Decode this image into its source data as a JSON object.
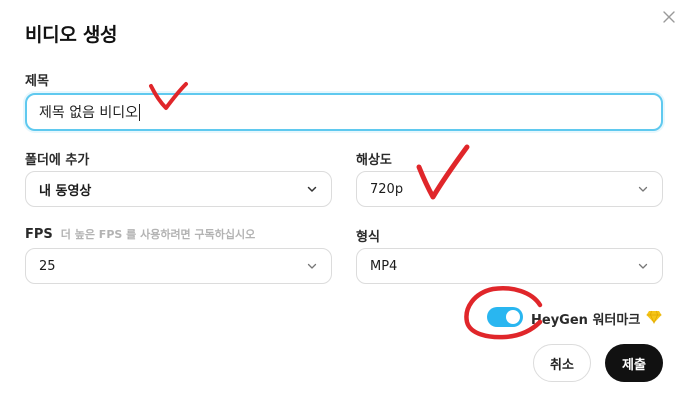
{
  "dialog": {
    "title": "비디오 생성"
  },
  "form": {
    "title_label": "제목",
    "title_value": "제목 없음 비디오",
    "folder_label": "폴더에 추가",
    "folder_value": "내 동영상",
    "resolution_label": "해상도",
    "resolution_value": "720p",
    "fps_label": "FPS",
    "fps_hint": "더 높은 FPS 를 사용하려면 구독하십시오",
    "fps_value": "25",
    "format_label": "형식",
    "format_value": "MP4",
    "watermark_label": "HeyGen 워터마크",
    "watermark_enabled": true
  },
  "buttons": {
    "cancel": "취소",
    "submit": "제출"
  },
  "icons": {
    "close": "close-icon",
    "chevron": "chevron-down-icon",
    "premium": "diamond-icon"
  },
  "colors": {
    "accent": "#29b6f0",
    "focus_border": "#5fc9ef",
    "annotation": "#e0262a",
    "premium": "#f5c518"
  }
}
